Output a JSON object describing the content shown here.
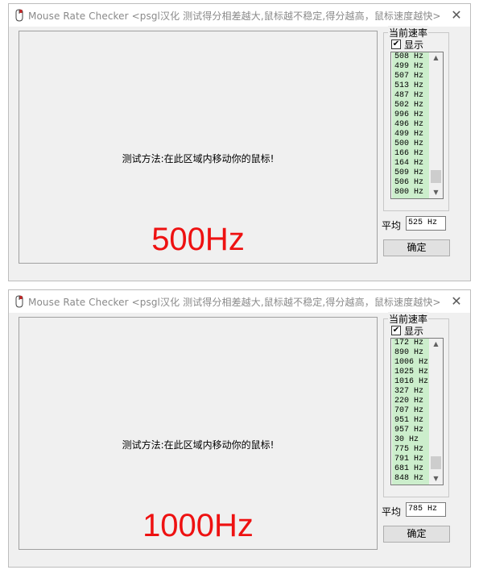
{
  "windows": [
    {
      "title": "Mouse Rate Checker <psgl汉化  测试得分相差越大,鼠标越不稳定,得分越高，鼠标速度越快>",
      "instruction": "测试方法:在此区域内移动你的鼠标!",
      "rate_label": "500Hz",
      "group_title": "当前速率",
      "show_label": "显示",
      "show_checked": "✔",
      "list": [
        "508 Hz",
        "499 Hz",
        "507 Hz",
        "513 Hz",
        "487 Hz",
        "502 Hz",
        "996 Hz",
        "496 Hz",
        "499 Hz",
        "500 Hz",
        "166 Hz",
        "164 Hz",
        "509 Hz",
        "506 Hz",
        "800 Hz"
      ],
      "avg_label": "平均",
      "avg_value": "525 Hz",
      "ok_label": "确定"
    },
    {
      "title": "Mouse Rate Checker <psgl汉化  测试得分相差越大,鼠标越不稳定,得分越高，鼠标速度越快>",
      "instruction": "测试方法:在此区域内移动你的鼠标!",
      "rate_label": "1000Hz",
      "group_title": "当前速率",
      "show_label": "显示",
      "show_checked": "✔",
      "list": [
        "172 Hz",
        "890 Hz",
        "1006 Hz",
        "1025 Hz",
        "1016 Hz",
        "327 Hz",
        "220 Hz",
        "707 Hz",
        "951 Hz",
        "957 Hz",
        "30 Hz",
        "775 Hz",
        "791 Hz",
        "681 Hz",
        "848 Hz"
      ],
      "avg_label": "平均",
      "avg_value": "785 Hz",
      "ok_label": "确定"
    }
  ],
  "icons": {
    "close": "close-icon",
    "app": "app-icon"
  },
  "colors": {
    "rate_label": "#ee1111",
    "list_bg": "#cceecc"
  }
}
